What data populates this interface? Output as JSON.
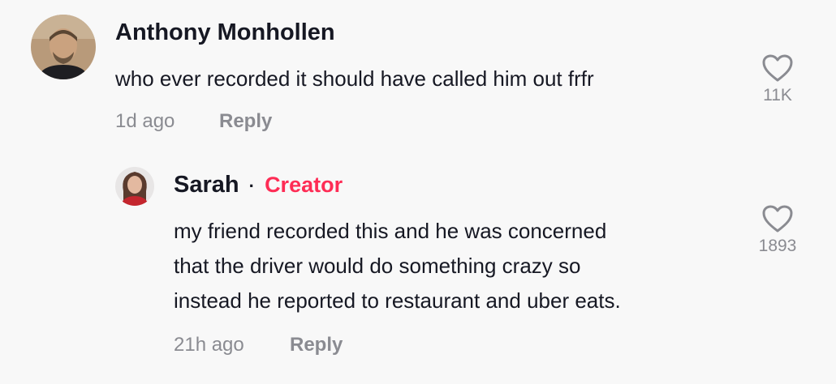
{
  "comments": [
    {
      "author": "Anthony Monhollen",
      "avatar_icon": "avatar-photo-icon",
      "text": "who ever recorded it should have called him out frfr",
      "time": "1d ago",
      "reply_label": "Reply",
      "like_icon": "heart-outline-icon",
      "like_count": "11K"
    }
  ],
  "replies": [
    {
      "author": "Sarah",
      "separator": "·",
      "badge": "Creator",
      "avatar_icon": "avatar-photo-icon",
      "text_lines": [
        "my friend recorded this and he was concerned",
        "that the driver would do something crazy so",
        "instead he reported to restaurant and uber eats."
      ],
      "time": "21h ago",
      "reply_label": "Reply",
      "like_icon": "heart-outline-icon",
      "like_count": "1893"
    }
  ],
  "colors": {
    "background": "#f8f8f8",
    "text": "#161823",
    "muted": "#8a8b91",
    "creator": "#fe2c55"
  }
}
